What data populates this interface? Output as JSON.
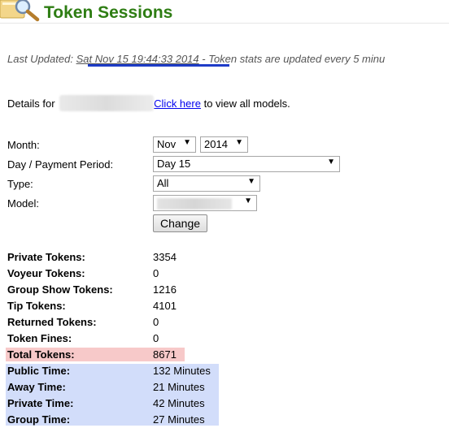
{
  "header": {
    "title": "Token Sessions",
    "icon": "magnifier-icon"
  },
  "last_updated": {
    "label": "Last Updated:",
    "date": "Sat Nov 15 19:44:33 2014",
    "note": " - Token stats are updated every 5 minu"
  },
  "details": {
    "prefix": "Details for",
    "link": "Click here",
    "suffix": "to view all models."
  },
  "form": {
    "month_label": "Month:",
    "month_value": "Nov",
    "year_value": "2014",
    "day_label": "Day / Payment Period:",
    "day_value": "Day 15",
    "type_label": "Type:",
    "type_value": "All",
    "model_label": "Model:",
    "change_button": "Change"
  },
  "stats": [
    {
      "label": "Private Tokens:",
      "value": "3354"
    },
    {
      "label": "Voyeur Tokens:",
      "value": "0"
    },
    {
      "label": "Group Show Tokens:",
      "value": "1216"
    },
    {
      "label": "Tip Tokens:",
      "value": "4101"
    },
    {
      "label": "Returned Tokens:",
      "value": "0"
    },
    {
      "label": "Token Fines:",
      "value": "0"
    },
    {
      "label": "Total Tokens:",
      "value": "8671"
    },
    {
      "label": "Public Time:",
      "value": "132 Minutes"
    },
    {
      "label": "Away Time:",
      "value": "21 Minutes"
    },
    {
      "label": "Private Time:",
      "value": "42 Minutes"
    },
    {
      "label": "Group Time:",
      "value": "27 Minutes"
    }
  ],
  "colors": {
    "title_green": "#2e7d13",
    "total_highlight": "#f7c9c9",
    "time_highlight": "#d2ddfa"
  }
}
